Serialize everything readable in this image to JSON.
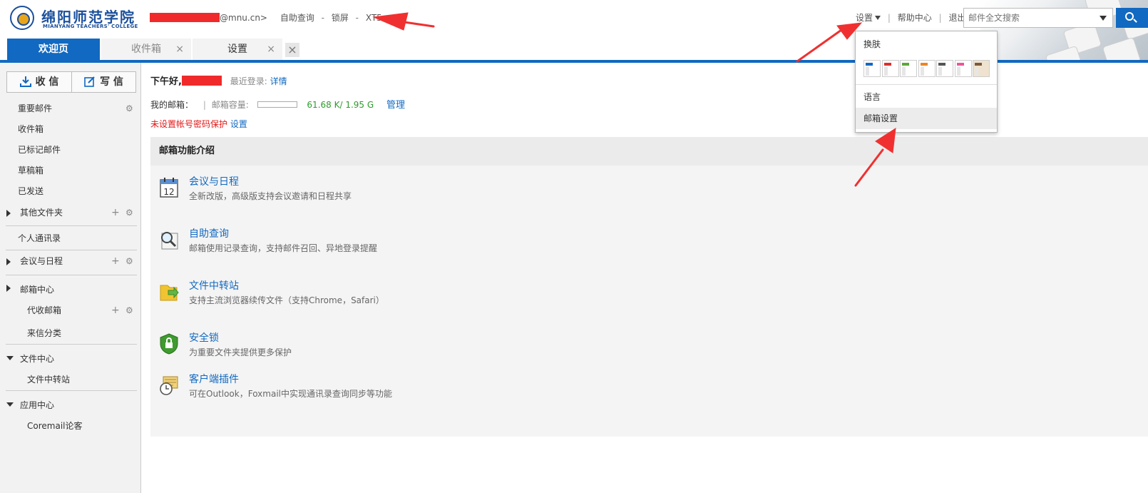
{
  "header": {
    "logo_cn": "绵阳师范学院",
    "logo_en": "MIANYANG TEACHERS' COLLEGE",
    "email_suffix": "@mnu.cn>",
    "links": [
      "自助查询",
      "锁屏",
      "XT5"
    ],
    "link_separator": "-",
    "nav": {
      "settings": "设置",
      "help": "帮助中心",
      "logout": "退出",
      "separator": "|"
    },
    "search_placeholder": "邮件全文搜索"
  },
  "tabs": [
    {
      "label": "欢迎页",
      "active": true
    },
    {
      "label": "收件箱",
      "close": "×"
    },
    {
      "label": "设置",
      "close": "×"
    }
  ],
  "tab_close_all": "×",
  "sidebar": {
    "receive": "收 信",
    "compose": "写 信",
    "items": [
      {
        "label": "重要邮件",
        "gear": true
      },
      {
        "label": "收件箱"
      },
      {
        "label": "已标记邮件"
      },
      {
        "label": "草稿箱"
      },
      {
        "label": "已发送"
      },
      {
        "label": "其他文件夹",
        "collapsed": true,
        "plus": true,
        "gear": true
      },
      {
        "label": "个人通讯录"
      },
      {
        "label": "会议与日程",
        "collapsed": true,
        "plus": true,
        "gear": true
      },
      {
        "label": "邮箱中心",
        "collapsed": true
      },
      {
        "label": "代收邮箱",
        "sub": true,
        "plus": true,
        "gear": true
      },
      {
        "label": "来信分类"
      },
      {
        "label": "文件中心",
        "expanded": true
      },
      {
        "label": "文件中转站",
        "sub": true
      },
      {
        "label": "应用中心",
        "expanded": true
      },
      {
        "label": "Coremail论客",
        "sub": true
      }
    ],
    "plus_glyph": "+",
    "gear_glyph": "⚙"
  },
  "main": {
    "greeting": "下午好,",
    "last_login_label": "最近登录:",
    "last_login_link": "详情",
    "mailbox_label": "我的邮箱：",
    "separator": "|",
    "capacity_label": "邮箱容量:",
    "capacity_value": "61.68 K/ 1.95 G",
    "capacity_fraction": 0.0,
    "manage": "管理",
    "warning": "未设置帐号密码保护",
    "warning_link": "设置",
    "panel_title": "邮箱功能介绍",
    "features": [
      {
        "icon": "calendar-icon",
        "title": "会议与日程",
        "desc": "全新改版，高级版支持会议邀请和日程共享",
        "calendar_day": "12"
      },
      {
        "icon": "magnifier-icon",
        "title": "自助查询",
        "desc": "邮箱使用记录查询，支持邮件召回、异地登录提醒"
      },
      {
        "icon": "folder-transfer-icon",
        "title": "文件中转站",
        "desc": "支持主流浏览器续传文件（支持Chrome，Safari）"
      },
      {
        "icon": "shield-lock-icon",
        "title": "安全锁",
        "desc": "为重要文件夹提供更多保护"
      },
      {
        "icon": "clock-plugin-icon",
        "title": "客户端插件",
        "desc": "可在Outlook，Foxmail中实现通讯录查询同步等功能"
      }
    ]
  },
  "dropdown": {
    "skin_label": "换肤",
    "skins": [
      {
        "top": "#1169c1"
      },
      {
        "top": "#d9302c"
      },
      {
        "top": "#5aa73a"
      },
      {
        "top": "#e8862a"
      },
      {
        "top": "#555555"
      },
      {
        "top": "#e8579a"
      },
      {
        "top": "#7a5a3a",
        "bg": "#efe3cf"
      }
    ],
    "language": "语言",
    "mailbox_settings": "邮箱设置"
  },
  "colors": {
    "accent": "#1169c1",
    "annotation": "#f03030",
    "warning": "#e31818",
    "capacity": "#2e9a2e"
  }
}
